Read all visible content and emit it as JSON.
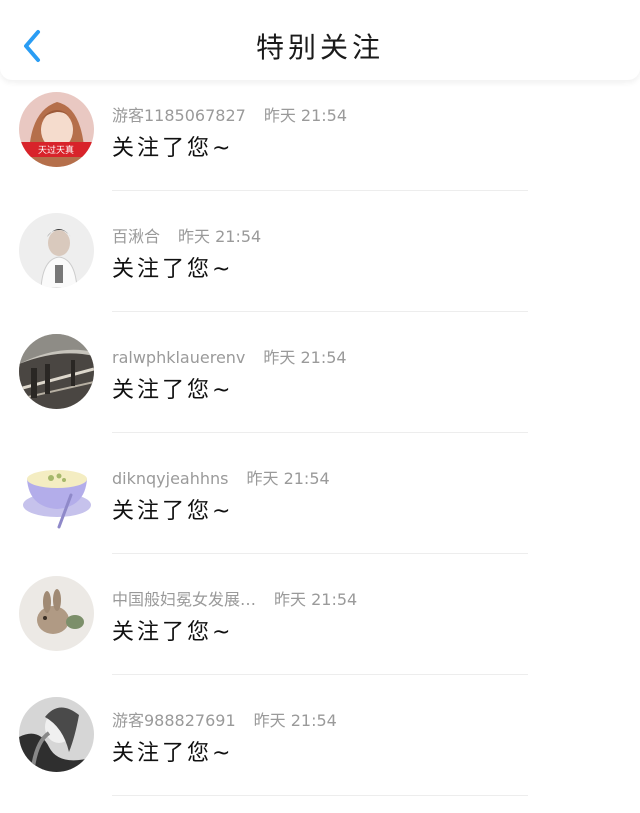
{
  "header": {
    "title": "特别关注",
    "back_icon": "chevron-left-icon"
  },
  "colors": {
    "accent": "#2a9df4",
    "text": "#111111",
    "meta": "#9a9a9a"
  },
  "items": [
    {
      "name": "游客1185067827",
      "time": "昨天 21:54",
      "message": "关注了您~",
      "avatar_label": "天过天真"
    },
    {
      "name": "百湫合",
      "time": "昨天 21:54",
      "message": "关注了您~"
    },
    {
      "name": "ralwphklauerenv",
      "time": "昨天 21:54",
      "message": "关注了您~"
    },
    {
      "name": "diknqyjeahhns",
      "time": "昨天 21:54",
      "message": "关注了您~"
    },
    {
      "name": "中国般妇冕女发展…",
      "time": "昨天 21:54",
      "message": "关注了您~"
    },
    {
      "name": "游客988827691",
      "time": "昨天 21:54",
      "message": "关注了您~"
    }
  ]
}
